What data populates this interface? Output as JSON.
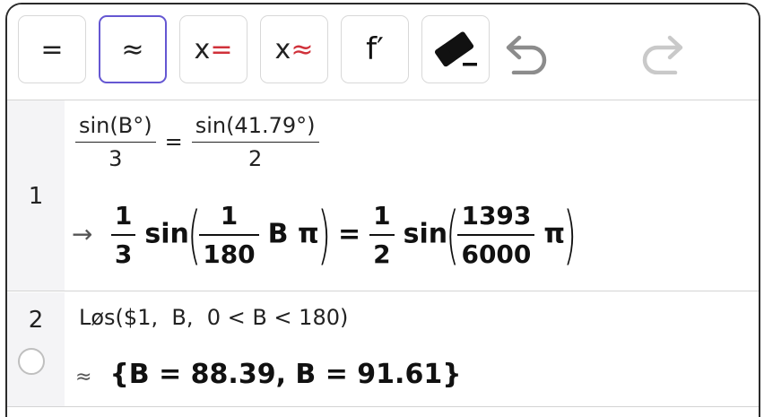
{
  "toolbar": {
    "buttons": [
      {
        "label": "="
      },
      {
        "label": "≈"
      },
      {
        "x": "x",
        "op": "="
      },
      {
        "x": "x",
        "op": "≈"
      },
      {
        "label": "f′"
      }
    ],
    "colors": {
      "accent": "#6557d2",
      "red": "#d0313a"
    }
  },
  "rows": [
    {
      "number": "1",
      "input": {
        "lhs_num": "sin(B°)",
        "lhs_den": "3",
        "eq": "=",
        "rhs_num": "sin(41.79°)",
        "rhs_den": "2"
      },
      "output": {
        "arrow": "→",
        "c1_num": "1",
        "c1_den": "3",
        "sin1": "sin",
        "a_num": "1",
        "a_den": "180",
        "a_tail": "B π",
        "eq": "=",
        "c2_num": "1",
        "c2_den": "2",
        "sin2": "sin",
        "b_num": "1393",
        "b_den": "6000",
        "b_tail": "π"
      }
    },
    {
      "number": "2",
      "input": "Løs($1,  B,  0 < B < 180)",
      "output_symbol": "≈",
      "output": "{B = 88.39, B = 91.61}"
    }
  ]
}
